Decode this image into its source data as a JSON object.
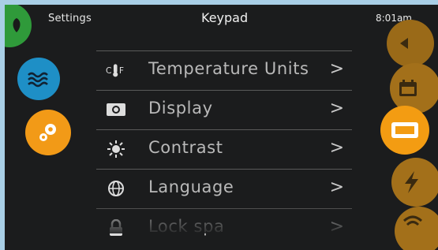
{
  "header": {
    "left_label": "Settings",
    "title": "Keypad",
    "time": "8:01am"
  },
  "left_nav": [
    {
      "icon": "leaf-icon",
      "color": "#2f9a3a"
    },
    {
      "icon": "water-waves-icon",
      "color": "#1e8fc6"
    },
    {
      "icon": "gears-icon",
      "color": "#f29a17",
      "selected": true
    }
  ],
  "right_nav": [
    {
      "icon": "arrow-icon",
      "color": "#9a6a18"
    },
    {
      "icon": "calendar-icon",
      "color": "#a3701a"
    },
    {
      "icon": "keypad-icon",
      "color": "#f39c12",
      "selected": true
    },
    {
      "icon": "lightning-icon",
      "color": "#a3701a"
    },
    {
      "icon": "wifi-icon",
      "color": "#a3701a"
    }
  ],
  "menu": [
    {
      "label": "Temperature Units",
      "icon": "thermometer-icon",
      "icon_left": "C",
      "icon_right": "F",
      "chevron": ">"
    },
    {
      "label": "Display",
      "icon": "display-icon",
      "chevron": ">"
    },
    {
      "label": "Contrast",
      "icon": "sun-icon",
      "chevron": ">"
    },
    {
      "label": "Language",
      "icon": "globe-icon",
      "chevron": ">"
    },
    {
      "label": "Lock spa",
      "icon": "lock-icon",
      "chevron": ">"
    }
  ]
}
